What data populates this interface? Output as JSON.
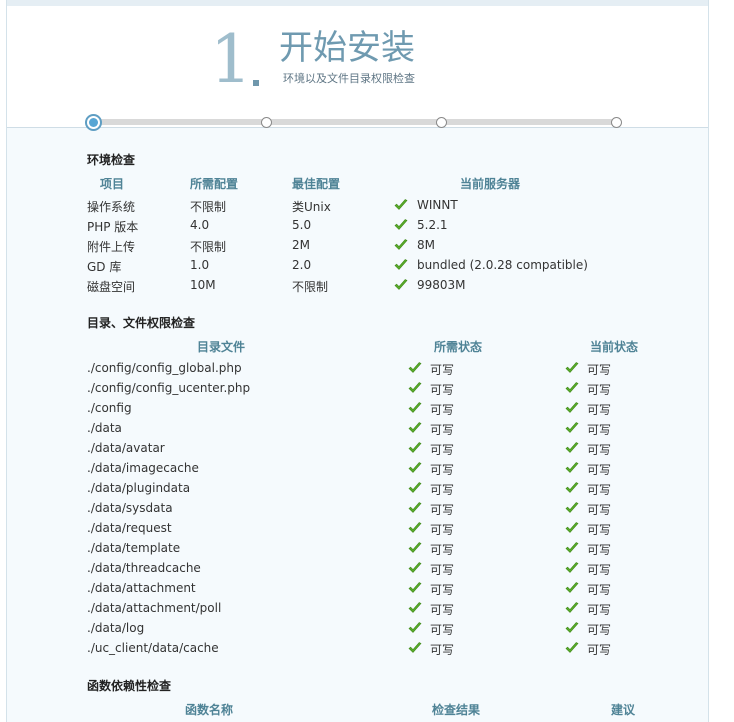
{
  "header": {
    "step_number": "1",
    "title": "开始安装",
    "subtitle": "环境以及文件目录权限检查"
  },
  "progress": {
    "current_step": 1,
    "total_steps": 4
  },
  "env_check": {
    "title": "环境检查",
    "columns": [
      "项目",
      "所需配置",
      "最佳配置",
      "当前服务器"
    ],
    "rows": [
      {
        "item": "操作系统",
        "required": "不限制",
        "best": "类Unix",
        "current": "WINNT",
        "ok": true
      },
      {
        "item": "PHP 版本",
        "required": "4.0",
        "best": "5.0",
        "current": "5.2.1",
        "ok": true
      },
      {
        "item": "附件上传",
        "required": "不限制",
        "best": "2M",
        "current": "8M",
        "ok": true
      },
      {
        "item": "GD 库",
        "required": "1.0",
        "best": "2.0",
        "current": "bundled (2.0.28 compatible)",
        "ok": true
      },
      {
        "item": "磁盘空间",
        "required": "10M",
        "best": "不限制",
        "current": "99803M",
        "ok": true
      }
    ]
  },
  "dir_check": {
    "title": "目录、文件权限检查",
    "columns": [
      "目录文件",
      "所需状态",
      "当前状态"
    ],
    "rows": [
      {
        "path": "./config/config_global.php",
        "required": "可写",
        "current": "可写"
      },
      {
        "path": "./config/config_ucenter.php",
        "required": "可写",
        "current": "可写"
      },
      {
        "path": "./config",
        "required": "可写",
        "current": "可写"
      },
      {
        "path": "./data",
        "required": "可写",
        "current": "可写"
      },
      {
        "path": "./data/avatar",
        "required": "可写",
        "current": "可写"
      },
      {
        "path": "./data/imagecache",
        "required": "可写",
        "current": "可写"
      },
      {
        "path": "./data/plugindata",
        "required": "可写",
        "current": "可写"
      },
      {
        "path": "./data/sysdata",
        "required": "可写",
        "current": "可写"
      },
      {
        "path": "./data/request",
        "required": "可写",
        "current": "可写"
      },
      {
        "path": "./data/template",
        "required": "可写",
        "current": "可写"
      },
      {
        "path": "./data/threadcache",
        "required": "可写",
        "current": "可写"
      },
      {
        "path": "./data/attachment",
        "required": "可写",
        "current": "可写"
      },
      {
        "path": "./data/attachment/poll",
        "required": "可写",
        "current": "可写"
      },
      {
        "path": "./data/log",
        "required": "可写",
        "current": "可写"
      },
      {
        "path": "./uc_client/data/cache",
        "required": "可写",
        "current": "可写"
      }
    ]
  },
  "func_check": {
    "title": "函数依赖性检查",
    "columns": [
      "函数名称",
      "检查结果",
      "建议"
    ]
  },
  "icons": {
    "check": "check-icon"
  },
  "colors": {
    "check": "#5aab2a",
    "heading_accent": "#4f8396",
    "title": "#6f9ab0"
  }
}
